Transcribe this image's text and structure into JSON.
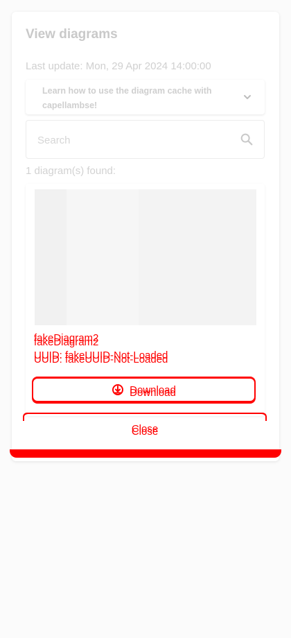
{
  "dialog": {
    "title": "View diagrams",
    "last_update": "Last update: Mon, 29 Apr 2024 14:00:00",
    "accordion": {
      "text": "Learn how to use the diagram cache with capellambse!",
      "icon": "chevron-down-icon"
    },
    "search": {
      "placeholder": "Search",
      "value": "",
      "icon": "search-icon"
    },
    "found_count": "1 diagram(s) found:",
    "diagrams": [
      {
        "name": "fakeDiagram2",
        "uuid": "UUID: fakeUUID-Not-Loaded",
        "download_label": "Download",
        "download_icon": "download-icon"
      }
    ],
    "close_label": "Close"
  },
  "colors": {
    "accent_red": "#ff0000",
    "muted_text": "#cfcfcf",
    "background": "#fbfbfb",
    "card_bg": "#ffffff"
  }
}
